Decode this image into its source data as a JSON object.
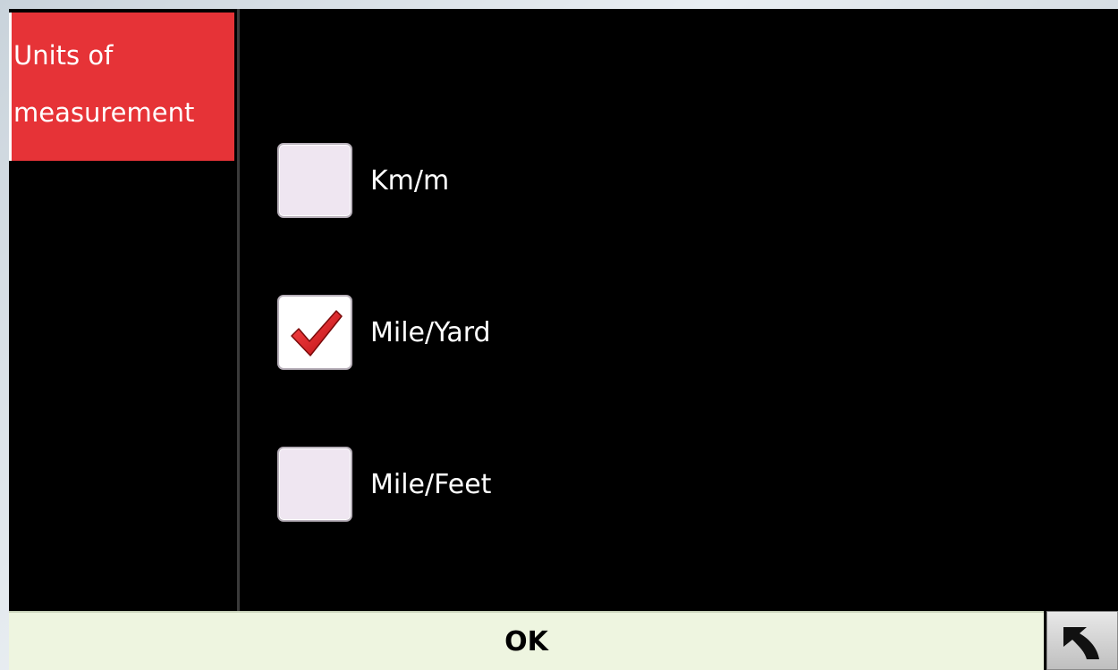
{
  "sidebar": {
    "category_line1": "Units of",
    "category_line2": "measurement"
  },
  "options": [
    {
      "label": "Km/m",
      "checked": false
    },
    {
      "label": "Mile/Yard",
      "checked": true
    },
    {
      "label": "Mile/Feet",
      "checked": false
    }
  ],
  "footer": {
    "ok_label": "OK",
    "back_icon": "undo-arrow-icon"
  },
  "colors": {
    "accent_red": "#e63337",
    "ok_background": "#eef5e0",
    "screen_background": "#000000"
  }
}
